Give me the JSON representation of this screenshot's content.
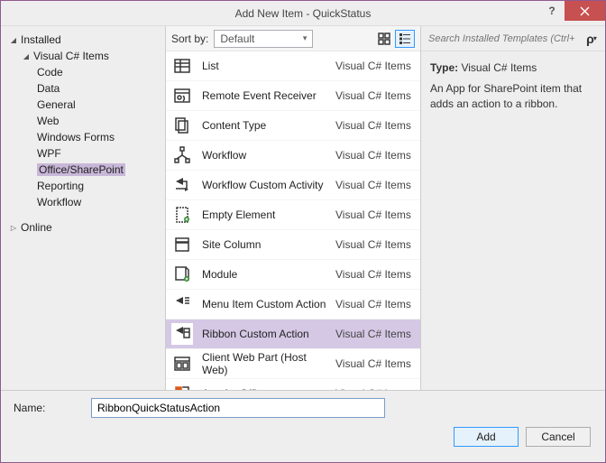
{
  "window": {
    "title": "Add New Item - QuickStatus"
  },
  "tree": {
    "installed": "Installed",
    "visual_csharp": "Visual C# Items",
    "children": [
      "Code",
      "Data",
      "General",
      "Web",
      "Windows Forms",
      "WPF",
      "Office/SharePoint",
      "Reporting",
      "Workflow"
    ],
    "online": "Online"
  },
  "toolbar": {
    "sortby_label": "Sort by:",
    "sortby_value": "Default"
  },
  "search": {
    "placeholder": "Search Installed Templates (Ctrl+E)"
  },
  "items": [
    {
      "name": "List",
      "cat": "Visual C# Items",
      "icon": "list"
    },
    {
      "name": "Remote Event Receiver",
      "cat": "Visual C# Items",
      "icon": "remote"
    },
    {
      "name": "Content Type",
      "cat": "Visual C# Items",
      "icon": "content"
    },
    {
      "name": "Workflow",
      "cat": "Visual C# Items",
      "icon": "workflow"
    },
    {
      "name": "Workflow Custom Activity",
      "cat": "Visual C# Items",
      "icon": "activity"
    },
    {
      "name": "Empty Element",
      "cat": "Visual C# Items",
      "icon": "empty"
    },
    {
      "name": "Site Column",
      "cat": "Visual C# Items",
      "icon": "column"
    },
    {
      "name": "Module",
      "cat": "Visual C# Items",
      "icon": "module"
    },
    {
      "name": "Menu Item Custom Action",
      "cat": "Visual C# Items",
      "icon": "menu"
    },
    {
      "name": "Ribbon Custom Action",
      "cat": "Visual C# Items",
      "icon": "ribbon",
      "selected": true
    },
    {
      "name": "Client Web Part (Host Web)",
      "cat": "Visual C# Items",
      "icon": "webpart"
    },
    {
      "name": "App for Office",
      "cat": "Visual C# Items",
      "icon": "office"
    }
  ],
  "detail": {
    "type_label": "Type:",
    "type_value": "Visual C# Items",
    "description": "An App for SharePoint item that adds an action to a ribbon."
  },
  "name_field": {
    "label": "Name:",
    "value": "RibbonQuickStatusAction"
  },
  "buttons": {
    "add": "Add",
    "cancel": "Cancel"
  }
}
